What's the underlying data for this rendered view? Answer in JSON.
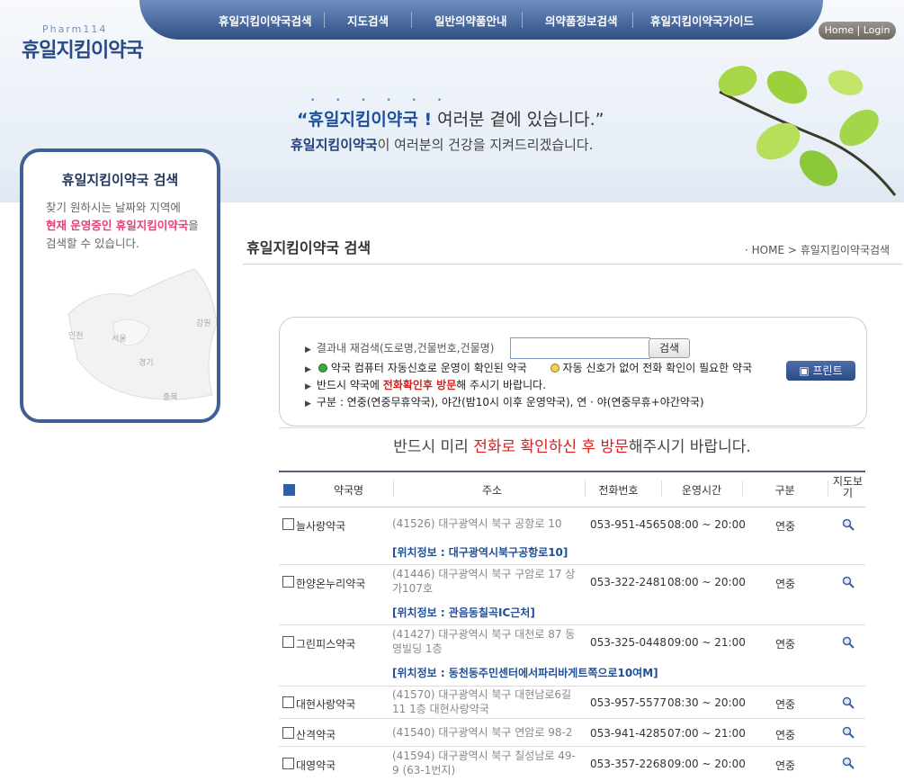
{
  "brand": {
    "sub": "Pharm114",
    "name": "휴일지킴이약국"
  },
  "nav": [
    {
      "label": "휴일지킴이약국검색"
    },
    {
      "label": "지도검색"
    },
    {
      "label": "일반의약품안내"
    },
    {
      "label": "의약품정보검색"
    },
    {
      "label": "휴일지킴이약국가이드"
    }
  ],
  "home_login": "Home | Login",
  "hero": {
    "dots": "• • • • • •",
    "line1_bold": "“휴일지킴이약국 !",
    "line1_rest": " 여러분 곁에 있습니다.”",
    "line2_bold": "휴일지킴이약국",
    "line2_rest": "이 여러분의 건강을 지켜드리겠습니다."
  },
  "sidebar": {
    "title": "휴일지킴이약국 검색",
    "text1": "찾기 원하시는 날짜와 지역에",
    "text2_pink": "현재 운영중인 휴일지킴이약국",
    "text2_rest": "을",
    "text3": "검색할 수 있습니다.",
    "map_labels": [
      "인천",
      "서울",
      "경기",
      "강원",
      "충북"
    ]
  },
  "page": {
    "title": "휴일지킴이약국 검색",
    "breadcrumb": "·  HOME  >  휴일지킴이약국검색"
  },
  "search": {
    "label": "결과내 재검색(도로명,건물번호,건물명)",
    "input_value": "",
    "button": "검색",
    "legend_green": "약국 컴퓨터 자동신호로 운영이 확인된 약국",
    "legend_yellow": "자동 신호가 없어 전화 확인이 필요한 약국",
    "visit_pre": "반드시 약국에 ",
    "visit_red": "전화확인후 방문",
    "visit_post": "해 주시기 바랍니다.",
    "category_text": "구분 : 연중(연중무휴약국), 야간(밤10시 이후 운영약국), 연 · 야(연중무휴+야간약국)",
    "print": "프린트"
  },
  "notice": {
    "pre": "반드시 미리 ",
    "red": "전화로 확인하신 후 방문",
    "post": "해주시기 바랍니다."
  },
  "table": {
    "headers": [
      "약국명",
      "주소",
      "전화번호",
      "운영시간",
      "구분",
      "지도보기"
    ],
    "rows": [
      {
        "name": "늘사랑약국",
        "addr1": "(41526) 대구광역시 북구 공항로 10",
        "addr2": "",
        "phone": "053-951-4565",
        "hours": "08:00 ~ 20:00",
        "type": "연중",
        "loc": "[위치정보 : 대구광역시북구공항로10]"
      },
      {
        "name": "한양온누리약국",
        "addr1": "(41446) 대구광역시 북구 구암로 17 상",
        "addr2": "가107호",
        "phone": "053-322-2481",
        "hours": "08:00 ~ 20:00",
        "type": "연중",
        "loc": "[위치정보 : 관음동칠곡IC근처]"
      },
      {
        "name": "그린피스약국",
        "addr1": "(41427) 대구광역시 북구 대천로 87 동",
        "addr2": "영빌딩 1층",
        "phone": "053-325-0448",
        "hours": "09:00 ~ 21:00",
        "type": "연중",
        "loc": "[위치정보 : 동천동주민센터에서파리바게트쪽으로10여M]"
      },
      {
        "name": "대현사랑약국",
        "addr1": "(41570) 대구광역시 북구 대현남로6길",
        "addr2": "11 1층 대현사랑약국",
        "phone": "053-957-5577",
        "hours": "08:30 ~ 20:00",
        "type": "연중",
        "loc": ""
      },
      {
        "name": "산격약국",
        "addr1": "(41540) 대구광역시 북구 연암로 98-2",
        "addr2": "",
        "phone": "053-941-4285",
        "hours": "07:00 ~ 21:00",
        "type": "연중",
        "loc": ""
      },
      {
        "name": "대영약국",
        "addr1": "(41594) 대구광역시 북구 칠성남로 49-",
        "addr2": "9 (63-1번지)",
        "phone": "053-357-2268",
        "hours": "09:00 ~ 20:00",
        "type": "연중",
        "loc": ""
      }
    ]
  }
}
